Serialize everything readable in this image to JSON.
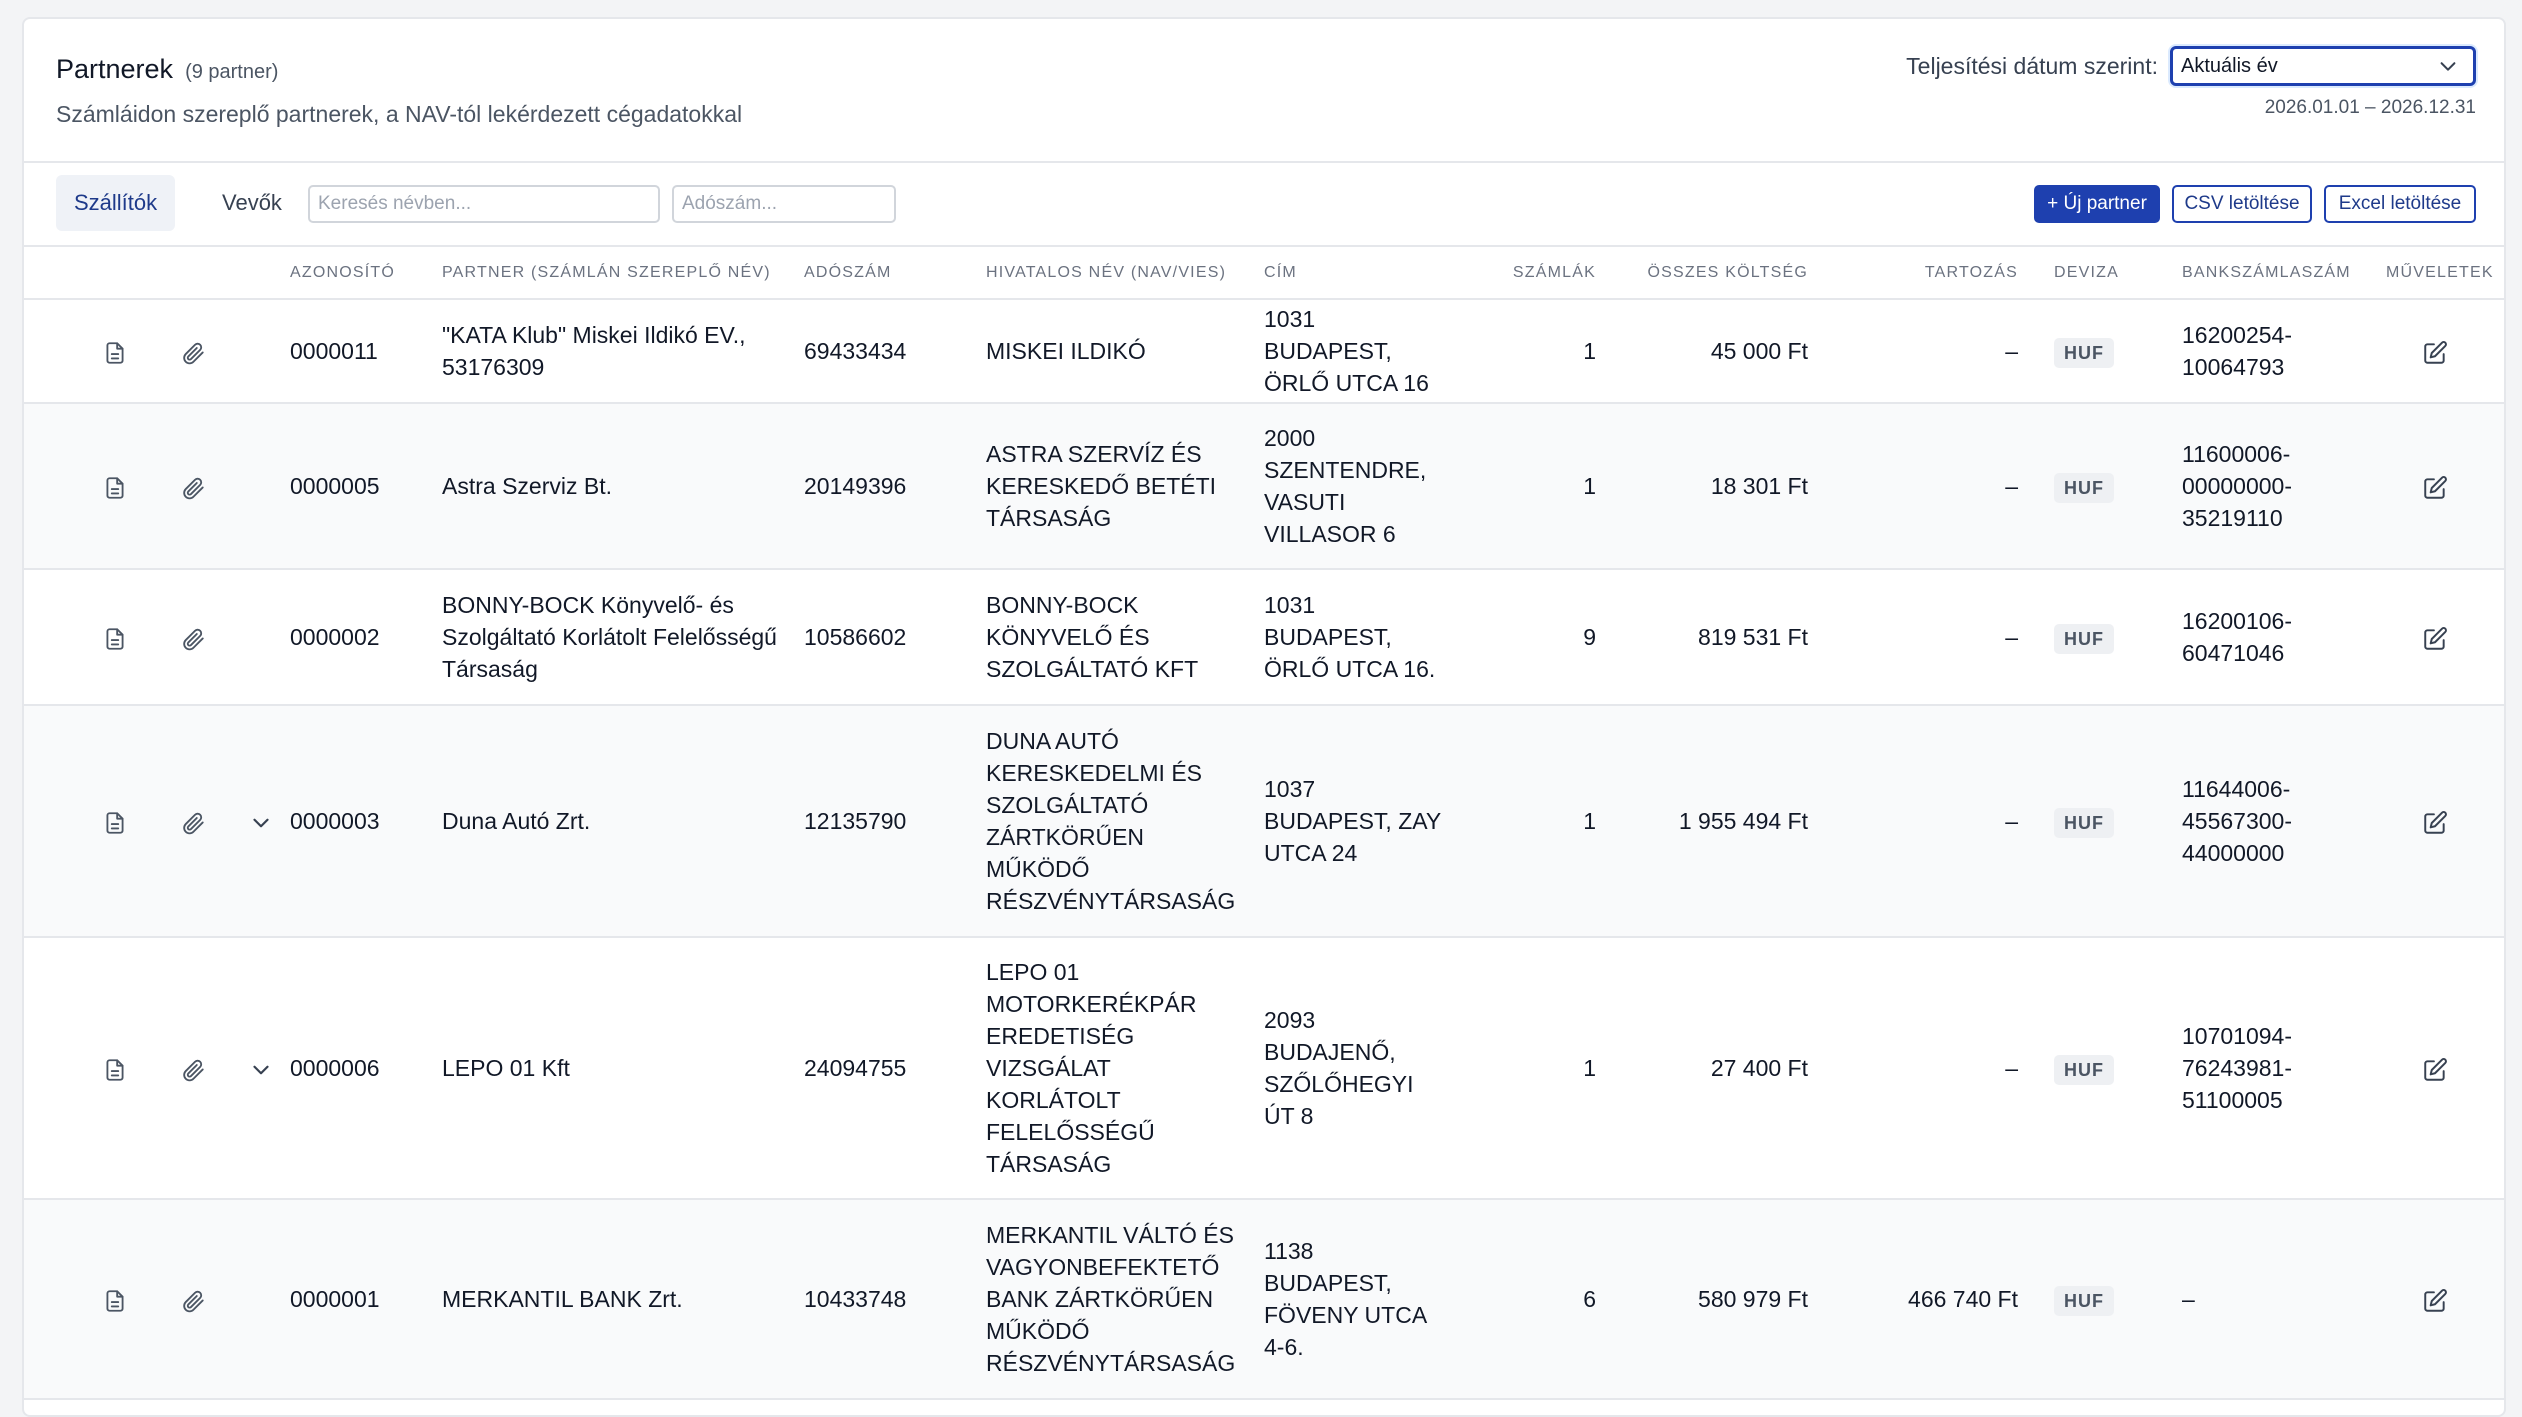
{
  "header": {
    "title": "Partnerek",
    "count": "(9 partner)",
    "subtitle": "Számláidon szereplő partnerek, a NAV-tól lekérdezett cégadatokkal",
    "date_filter_label": "Teljesítési dátum szerint:",
    "date_filter_value": "Aktuális év",
    "date_range": "2026.01.01 – 2026.12.31"
  },
  "toolbar": {
    "tabs": [
      {
        "label": "Szállítók",
        "active": true
      },
      {
        "label": "Vevők",
        "active": false
      }
    ],
    "search_name_placeholder": "Keresés névben...",
    "search_tax_placeholder": "Adószám...",
    "new_partner_label": "+ Új partner",
    "csv_label": "CSV letöltése",
    "excel_label": "Excel letöltése"
  },
  "table": {
    "columns": [
      "AZONOSÍTÓ",
      "PARTNER (SZÁMLÁN SZEREPLŐ NÉV)",
      "ADÓSZÁM",
      "HIVATALOS NÉV (NAV/VIES)",
      "CÍM",
      "SZÁMLÁK",
      "ÖSSZES KÖLTSÉG",
      "TARTOZÁS",
      "DEVIZA",
      "BANKSZÁMLASZÁM",
      "MŰVELETEK"
    ],
    "rows": [
      {
        "id": "0000011",
        "partner": "\"KATA Klub\" Miskei Ildikó EV., 53176309",
        "tax": "69433434",
        "official": "MISKEI ILDIKÓ",
        "address": "1031 BUDAPEST, ÖRLŐ UTCA 16",
        "invoices": "1",
        "total": "45 000 Ft",
        "debt": "–",
        "currency": "HUF",
        "bank": "16200254-10064793",
        "expand": false
      },
      {
        "id": "0000005",
        "partner": "Astra Szerviz Bt.",
        "tax": "20149396",
        "official": "ASTRA SZERVÍZ ÉS KERESKEDŐ BETÉTI TÁRSASÁG",
        "address": "2000 SZENTENDRE, VASUTI VILLASOR 6",
        "invoices": "1",
        "total": "18 301 Ft",
        "debt": "–",
        "currency": "HUF",
        "bank": "11600006-00000000-35219110",
        "expand": false
      },
      {
        "id": "0000002",
        "partner": "BONNY-BOCK Könyvelő- és Szolgáltató Korlátolt Felelősségű Társaság",
        "tax": "10586602",
        "official": "BONNY-BOCK KÖNYVELŐ ÉS SZOLGÁLTATÓ KFT",
        "address": "1031 BUDAPEST, ÖRLŐ UTCA 16.",
        "invoices": "9",
        "total": "819 531 Ft",
        "debt": "–",
        "currency": "HUF",
        "bank": "16200106-60471046",
        "expand": false
      },
      {
        "id": "0000003",
        "partner": "Duna Autó Zrt.",
        "tax": "12135790",
        "official": "DUNA AUTÓ KERESKEDELMI ÉS SZOLGÁLTATÓ ZÁRTKÖRŰEN MŰKÖDŐ RÉSZVÉNYTÁRSASÁG",
        "address": "1037 BUDAPEST, ZAY UTCA 24",
        "invoices": "1",
        "total": "1 955 494 Ft",
        "debt": "–",
        "currency": "HUF",
        "bank": "11644006-45567300-44000000",
        "expand": true
      },
      {
        "id": "0000006",
        "partner": "LEPO 01 Kft",
        "tax": "24094755",
        "official": "LEPO 01 MOTORKERÉKPÁR EREDETISÉG VIZSGÁLAT KORLÁTOLT FELELŐSSÉGŰ TÁRSASÁG",
        "address": "2093 BUDAJENŐ, SZŐLŐHEGYI ÚT 8",
        "invoices": "1",
        "total": "27 400 Ft",
        "debt": "–",
        "currency": "HUF",
        "bank": "10701094-76243981-51100005",
        "expand": true
      },
      {
        "id": "0000001",
        "partner": "MERKANTIL BANK Zrt.",
        "tax": "10433748",
        "official": "MERKANTIL VÁLTÓ ÉS VAGYONBEFEKTETŐ BANK ZÁRTKÖRŰEN MŰKÖDŐ RÉSZVÉNYTÁRSASÁG",
        "address": "1138 BUDAPEST, FÖVENY UTCA 4-6.",
        "invoices": "6",
        "total": "580 979 Ft",
        "debt": "466 740 Ft",
        "currency": "HUF",
        "bank": "–",
        "expand": false
      }
    ]
  },
  "icons": {
    "document": "document-icon",
    "attachment": "paperclip-icon",
    "expand": "chevron-down-icon",
    "edit": "edit-icon"
  },
  "colors": {
    "accent": "#1e40af",
    "border": "#e5e7eb",
    "muted_text": "#6b7280"
  }
}
